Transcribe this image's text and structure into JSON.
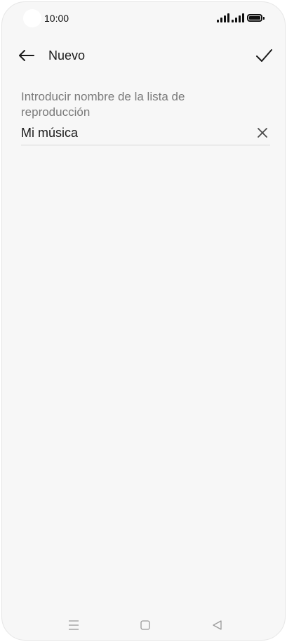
{
  "status_bar": {
    "time": "10:00",
    "icons": [
      "signal-icon",
      "signal-icon",
      "battery-icon"
    ]
  },
  "app_bar": {
    "title": "Nuevo",
    "back_icon": "arrow-left-icon",
    "confirm_icon": "checkmark-icon"
  },
  "form": {
    "label": "Introducir nombre de la lista de reproducción",
    "value": "Mi música",
    "clear_icon": "close-icon"
  },
  "nav_bar": {
    "items": [
      "menu-icon",
      "home-icon",
      "back-triangle-icon"
    ]
  },
  "colors": {
    "background": "#f7f7f7",
    "text": "#1a1a1a",
    "label": "#7a7a7a",
    "divider": "#d6d6d6"
  }
}
